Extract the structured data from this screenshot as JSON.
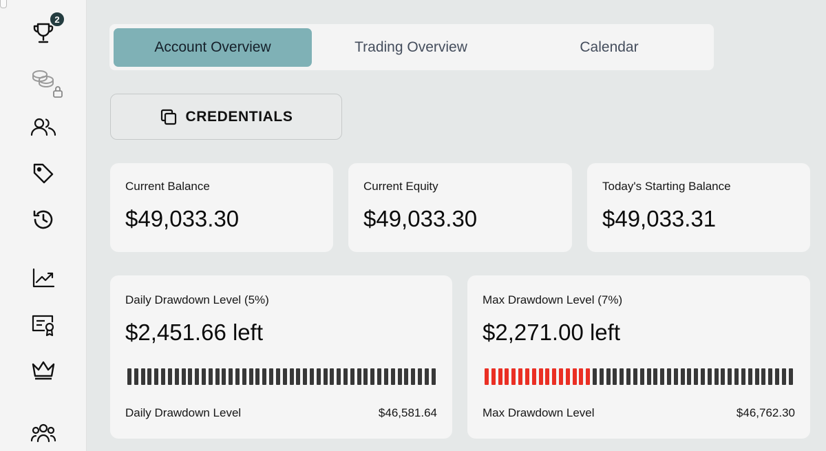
{
  "sidebar": {
    "items": [
      {
        "icon": "trophy-icon",
        "badge": "2"
      },
      {
        "icon": "coins-icon",
        "locked": true
      },
      {
        "icon": "users-icon"
      },
      {
        "icon": "tag-icon"
      },
      {
        "icon": "history-icon"
      },
      {
        "icon": "chart-line-icon"
      },
      {
        "icon": "certificate-icon"
      },
      {
        "icon": "crown-icon"
      },
      {
        "icon": "community-icon"
      }
    ]
  },
  "tabs": [
    {
      "label": "Account Overview",
      "active": true
    },
    {
      "label": "Trading Overview",
      "active": false
    },
    {
      "label": "Calendar",
      "active": false
    }
  ],
  "credentials": {
    "label": "CREDENTIALS",
    "icon": "copy-icon"
  },
  "stats": [
    {
      "label": "Current Balance",
      "value": "$49,033.30"
    },
    {
      "label": "Current Equity",
      "value": "$49,033.30"
    },
    {
      "label": "Today's Starting Balance",
      "value": "$49,033.31"
    }
  ],
  "drawdowns": [
    {
      "label": "Daily Drawdown Level (5%)",
      "value": "$2,451.66 left",
      "used_fraction": 0.0,
      "footer_label": "Daily Drawdown Level",
      "footer_value": "$46,581.64"
    },
    {
      "label": "Max Drawdown Level (7%)",
      "value": "$2,271.00 left",
      "used_fraction": 0.34,
      "footer_label": "Max Drawdown Level",
      "footer_value": "$46,762.30"
    }
  ],
  "colors": {
    "accent_tab": "#7fb1b6",
    "bar_remaining": "#383838",
    "bar_used": "#ea2f24",
    "badge": "#243c40"
  }
}
